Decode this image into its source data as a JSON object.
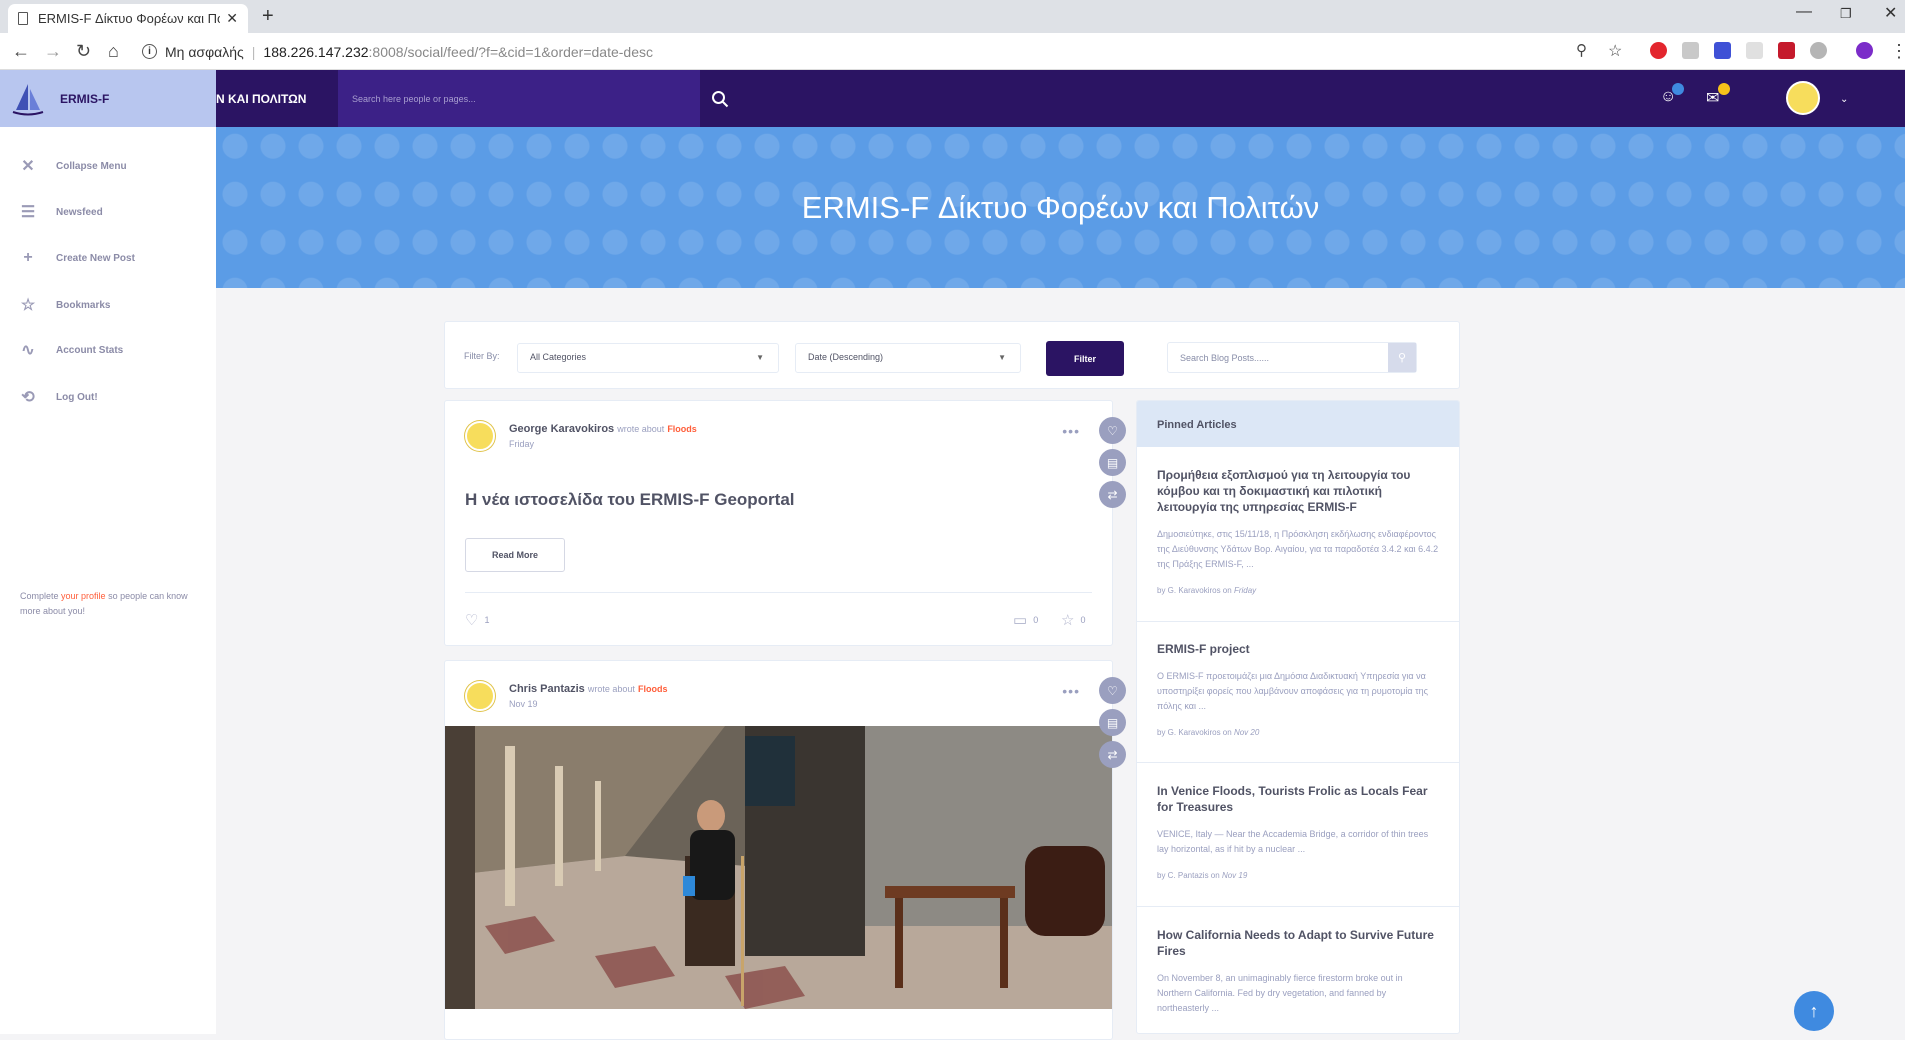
{
  "browser": {
    "tab_title": "ERMIS-F Δίκτυο Φορέων και Πολ",
    "security_label": "Μη ασφαλής",
    "url_host": "188.226.147.232",
    "url_path": ":8008/social/feed/?f=&cid=1&order=date-desc"
  },
  "header": {
    "brand": "ERMIS-F",
    "site_name": "Ν ΚΑΙ ΠΟΛΙΤΩΝ",
    "search_placeholder": "Search here people or pages...",
    "colors": {
      "primary": "#2b1463",
      "accent": "#ff5e3a",
      "banner": "#5b9ce6"
    }
  },
  "sidebar": {
    "items": [
      {
        "label": "Collapse Menu",
        "icon": "close-icon"
      },
      {
        "label": "Newsfeed",
        "icon": "newsfeed-icon"
      },
      {
        "label": "Create New Post",
        "icon": "plus-icon"
      },
      {
        "label": "Bookmarks",
        "icon": "star-icon"
      },
      {
        "label": "Account Stats",
        "icon": "stats-icon"
      },
      {
        "label": "Log Out!",
        "icon": "logout-icon"
      }
    ],
    "note_prefix": "Complete ",
    "note_link": "your profile",
    "note_suffix": " so people can know more about you!"
  },
  "banner": {
    "title": "ERMIS-F Δίκτυο Φορέων και Πολιτών"
  },
  "filter": {
    "label": "Filter By:",
    "category": "All Categories",
    "order": "Date (Descending)",
    "button": "Filter",
    "search_placeholder": "Search Blog Posts......"
  },
  "posts": [
    {
      "author": "George Karavokiros",
      "wrote": "wrote about",
      "category": "Floods",
      "date": "Friday",
      "title": "Η νέα ιστοσελίδα του ERMIS-F Geoportal",
      "read_more": "Read More",
      "likes": "1",
      "comments": "0",
      "stars": "0"
    },
    {
      "author": "Chris Pantazis",
      "wrote": "wrote about",
      "category": "Floods",
      "date": "Nov 19"
    }
  ],
  "pinned": {
    "heading": "Pinned Articles",
    "articles": [
      {
        "title": "Προμήθεια εξοπλισμού για τη λειτουργία του κόμβου και τη δοκιμαστική και πιλοτική λειτουργία της υπηρεσίας ERMIS-F",
        "excerpt": "Δημοσιεύτηκε, στις 15/11/18, η Πρόσκληση εκδήλωσης ενδιαφέροντος της Διεύθυνσης Υδάτων Βορ. Αιγαίου, για τα παραδοτέα 3.4.2 και 6.4.2 της Πράξης ERMIS-F, ...",
        "by": "by G. Karavokiros on",
        "date": "Friday"
      },
      {
        "title": "ERMIS-F project",
        "excerpt": "Ο ERMIS-F προετοιμάζει μια Δημόσια Διαδικτυακή Υπηρεσία για να υποστηρίξει φορείς που λαμβάνουν αποφάσεις για τη ρυμοτομία της πόλης και ...",
        "by": "by G. Karavokiros on",
        "date": "Nov 20"
      },
      {
        "title": "In Venice Floods, Tourists Frolic as Locals Fear for Treasures",
        "excerpt": "VENICE, Italy — Near the Accademia Bridge, a corridor of thin trees lay horizontal, as if hit by a nuclear ...",
        "by": "by C. Pantazis on",
        "date": "Nov 19"
      },
      {
        "title": "How California Needs to Adapt to Survive Future Fires",
        "excerpt": "On November 8, an unimaginably fierce firestorm broke out in Northern California. Fed by dry vegetation, and fanned by northeasterly ...",
        "by": "",
        "date": ""
      }
    ]
  }
}
